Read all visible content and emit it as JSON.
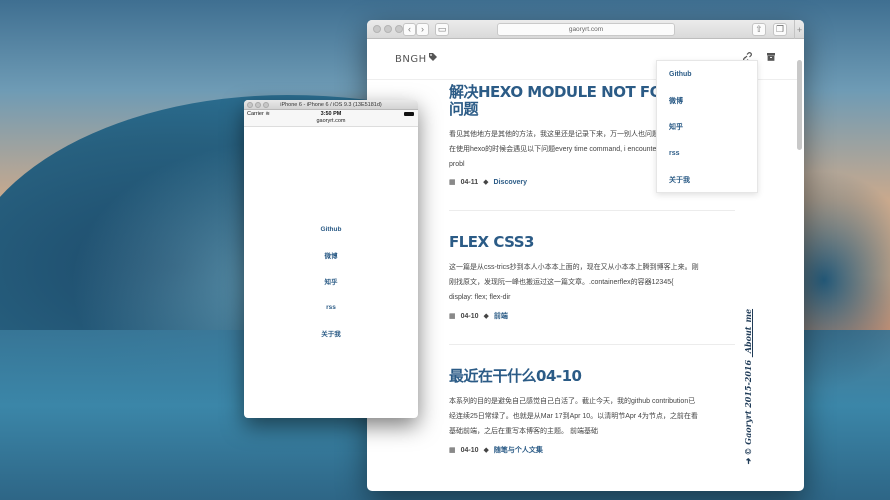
{
  "safari": {
    "url": "gaoryrt.com",
    "nav": {
      "brand": "BNGH"
    },
    "dropdown": [
      "Github",
      "微博",
      "知乎",
      "rss",
      "关于我"
    ],
    "posts": [
      {
        "title": "解决HEXO MODULE NOT FOUND问题",
        "excerpt": "看见其他地方是其他的方法，我这里还是记录下来，万一别人也问题 PROBLEM在使用hexo的时候会遇见以下问题every time command, i encounter following probl",
        "date": "04-11",
        "tag": "Discovery"
      },
      {
        "title": "FLEX CSS3",
        "excerpt": "这一篇是从css-trics抄到本人小本本上面的，现在又从小本本上腾到博客上来。刚刚找原文，发现阮一峰也搬运过这一篇文章。.containerflex的容器12345{ display: flex; flex-dir",
        "date": "04-10",
        "tag": "前端"
      },
      {
        "title": "最近在干什么04-10",
        "excerpt": "本系列的目的是避免自己感觉自己白活了。截止今天，我的github contribution已经连续25日常绿了。也就是从Mar 17到Apr 10。以清明节Apr 4为节点，之前在看基础前端，之后在重写本博客的主题。 前端基础",
        "date": "04-10",
        "tag": "随笔与个人文集"
      }
    ],
    "footer": {
      "arrow": "➜",
      "copyright": "© Gaoryrt 2015-2016",
      "about": "_About_me"
    }
  },
  "simulator": {
    "title": "iPhone 6 - iPhone 6 / iOS 9.3 (13E5181d)",
    "carrier": "Carrier",
    "time": "3:50 PM",
    "url": "gaoryrt.com",
    "menu": [
      "Github",
      "微博",
      "知乎",
      "rss",
      "关于我"
    ]
  },
  "colors": {
    "link": "#2b5b86",
    "text": "#444444"
  }
}
